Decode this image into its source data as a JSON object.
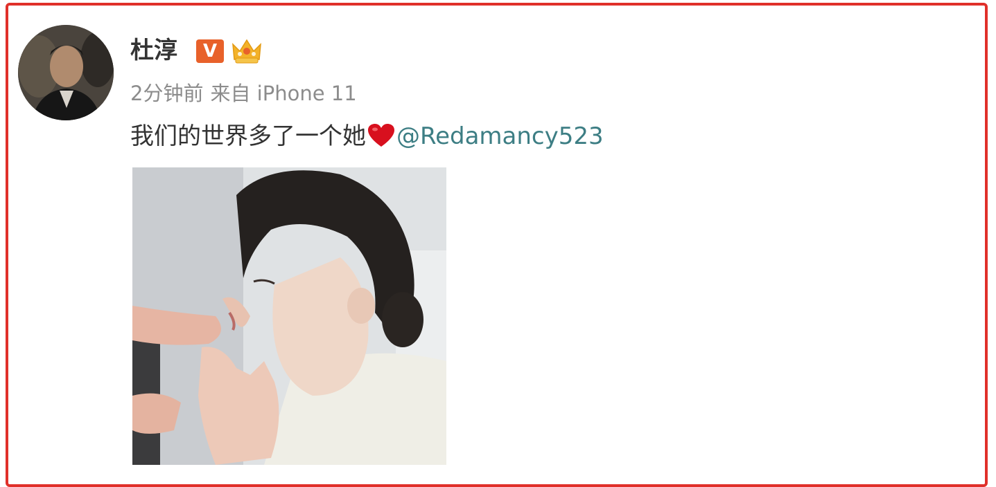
{
  "post": {
    "author": "杜淳",
    "verified_badge": "V",
    "meta_time": "2分钟前",
    "meta_source": "来自 iPhone 11",
    "text": "我们的世界多了一个她",
    "mention": "@Redamancy523",
    "icons": {
      "verified": "verified-v-icon",
      "membership": "crown-icon",
      "emoji": "red-heart-icon"
    }
  },
  "colors": {
    "frame_border": "#e0302a",
    "mention_link": "#3d7e84",
    "badge_orange": "#e8612a",
    "heart_red": "#d8101e"
  }
}
